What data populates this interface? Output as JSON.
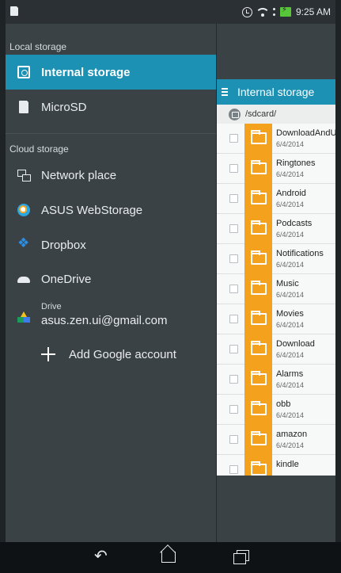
{
  "status_bar": {
    "time": "9:25 AM"
  },
  "drawer": {
    "local_header": "Local storage",
    "local_items": [
      {
        "label": "Internal storage",
        "icon": "internal-storage-icon",
        "selected": true
      },
      {
        "label": "MicroSD",
        "icon": "sd-card-icon",
        "selected": false
      }
    ],
    "cloud_header": "Cloud storage",
    "cloud_items": [
      {
        "label": "Network place",
        "icon": "network-icon"
      },
      {
        "label": "ASUS WebStorage",
        "icon": "asus-webstorage-icon"
      },
      {
        "label": "Dropbox",
        "icon": "dropbox-icon"
      },
      {
        "label": "OneDrive",
        "icon": "onedrive-icon"
      }
    ],
    "drive": {
      "label": "Drive",
      "account": "asus.zen.ui@gmail.com"
    },
    "add_account": "Add Google account"
  },
  "panel": {
    "title": "Internal storage",
    "path": "/sdcard/",
    "files": [
      {
        "name": "DownloadAndUp",
        "date": "6/4/2014"
      },
      {
        "name": "Ringtones",
        "date": "6/4/2014"
      },
      {
        "name": "Android",
        "date": "6/4/2014"
      },
      {
        "name": "Podcasts",
        "date": "6/4/2014"
      },
      {
        "name": "Notifications",
        "date": "6/4/2014"
      },
      {
        "name": "Music",
        "date": "6/4/2014"
      },
      {
        "name": "Movies",
        "date": "6/4/2014"
      },
      {
        "name": "Download",
        "date": "6/4/2014"
      },
      {
        "name": "Alarms",
        "date": "6/4/2014"
      },
      {
        "name": "obb",
        "date": "6/4/2014"
      },
      {
        "name": "amazon",
        "date": "6/4/2014"
      },
      {
        "name": "kindle",
        "date": ""
      }
    ]
  },
  "colors": {
    "accent": "#1c91b3",
    "folder": "#f4a21e",
    "drawer_bg": "#3b4246"
  }
}
